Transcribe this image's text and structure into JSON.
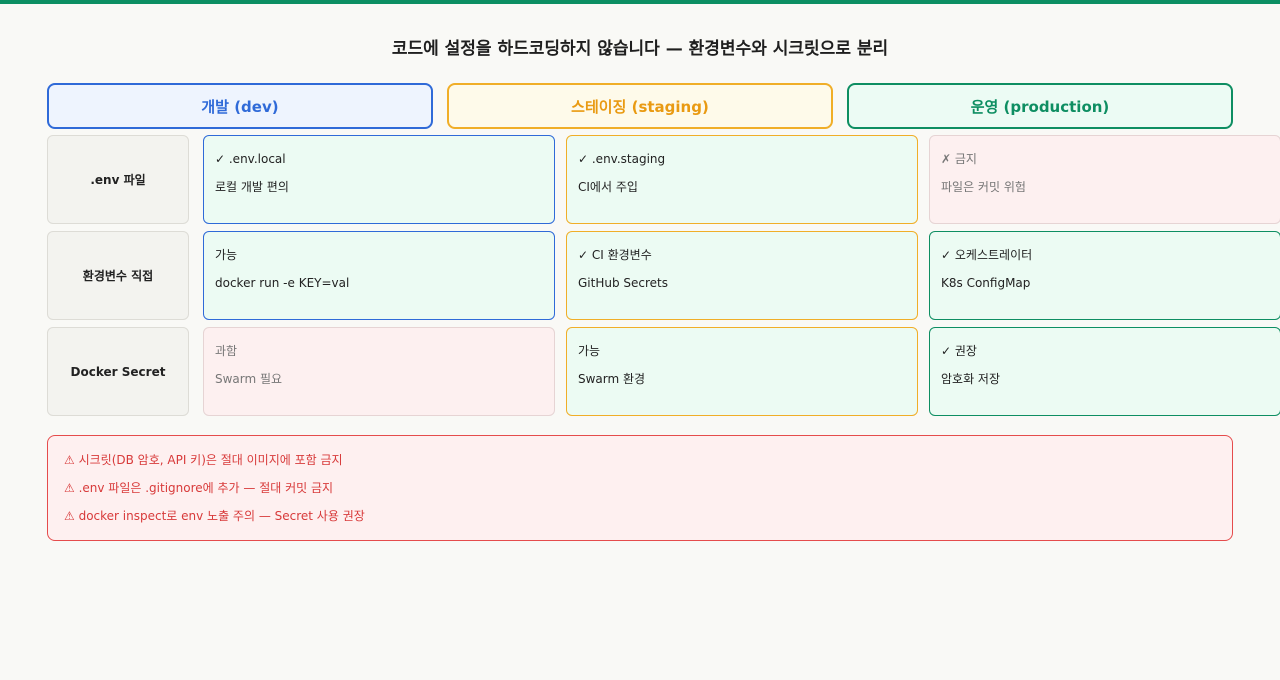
{
  "title": "코드에 설정을 하드코딩하지 않습니다 — 환경변수와 시크릿으로 분리",
  "columns": [
    {
      "label": "개발 (dev)"
    },
    {
      "label": "스테이징 (staging)"
    },
    {
      "label": "운영 (production)"
    }
  ],
  "rows": [
    {
      "label": ".env 파일",
      "cells": [
        {
          "title": "✓ .env.local",
          "desc": "로컬 개발 편의"
        },
        {
          "title": "✓ .env.staging",
          "desc": "CI에서 주입"
        },
        {
          "title": "✗ 금지",
          "desc": "파일은 커밋 위험"
        }
      ]
    },
    {
      "label": "환경변수 직접",
      "cells": [
        {
          "title": "가능",
          "desc": "docker run -e KEY=val"
        },
        {
          "title": "✓ CI 환경변수",
          "desc": "GitHub Secrets"
        },
        {
          "title": "✓ 오케스트레이터",
          "desc": "K8s ConfigMap"
        }
      ]
    },
    {
      "label": "Docker Secret",
      "cells": [
        {
          "title": "과함",
          "desc": "Swarm 필요"
        },
        {
          "title": "가능",
          "desc": "Swarm 환경"
        },
        {
          "title": "✓ 권장",
          "desc": "암호화 저장"
        }
      ]
    }
  ],
  "warnings": [
    "⚠ 시크릿(DB 암호, API 키)은 절대 이미지에 포함 금지",
    "⚠ .env 파일은 .gitignore에 추가 — 절대 커밋 금지",
    "⚠ docker inspect로 env 노출 주의 — Secret 사용 권장"
  ],
  "colors": {
    "dev": "#2f6ad8",
    "staging": "#f0ae28",
    "production": "#0e8e62",
    "warning": "#e54c4c",
    "top_bar": "#0c8f63"
  }
}
